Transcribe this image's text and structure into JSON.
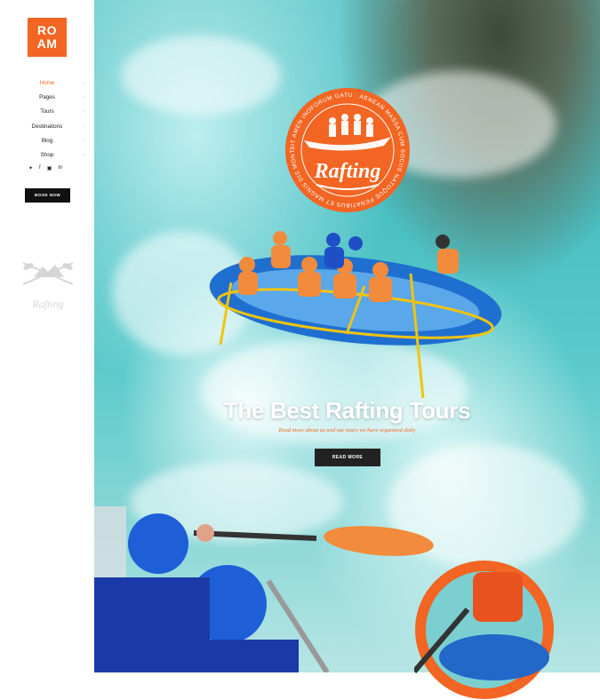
{
  "brand": {
    "logo_line1": "RO",
    "logo_line2": "AM"
  },
  "nav": {
    "items": [
      {
        "label": "Home",
        "active": true
      },
      {
        "label": "Pages"
      },
      {
        "label": "Tours"
      },
      {
        "label": "Destinations"
      },
      {
        "label": "Blog"
      },
      {
        "label": "Shop"
      }
    ],
    "chevron": "›"
  },
  "social": {
    "icons": [
      "twitter-icon",
      "facebook-icon",
      "instagram-icon",
      "linkedin-icon"
    ],
    "twitter": "✦",
    "facebook": "f",
    "instagram": "▣",
    "linkedin": "in"
  },
  "book_button": "BOOK NOW",
  "watermark_text": "Rafting",
  "badge": {
    "title": "Rafting",
    "ring_text": "SIT AMEN INOFORUM GATU · AENEAN MASSA CUM SOCIIS NATOQUE PENATIBUS ET MAGNIS DIS MONTES GERO LAMA"
  },
  "hero": {
    "headline": "The Best Rafting Tours",
    "subtitle": "Read more about us and our tours we have organized daily",
    "button": "READ MORE"
  },
  "colors": {
    "accent": "#f26522",
    "dark": "#111111"
  }
}
